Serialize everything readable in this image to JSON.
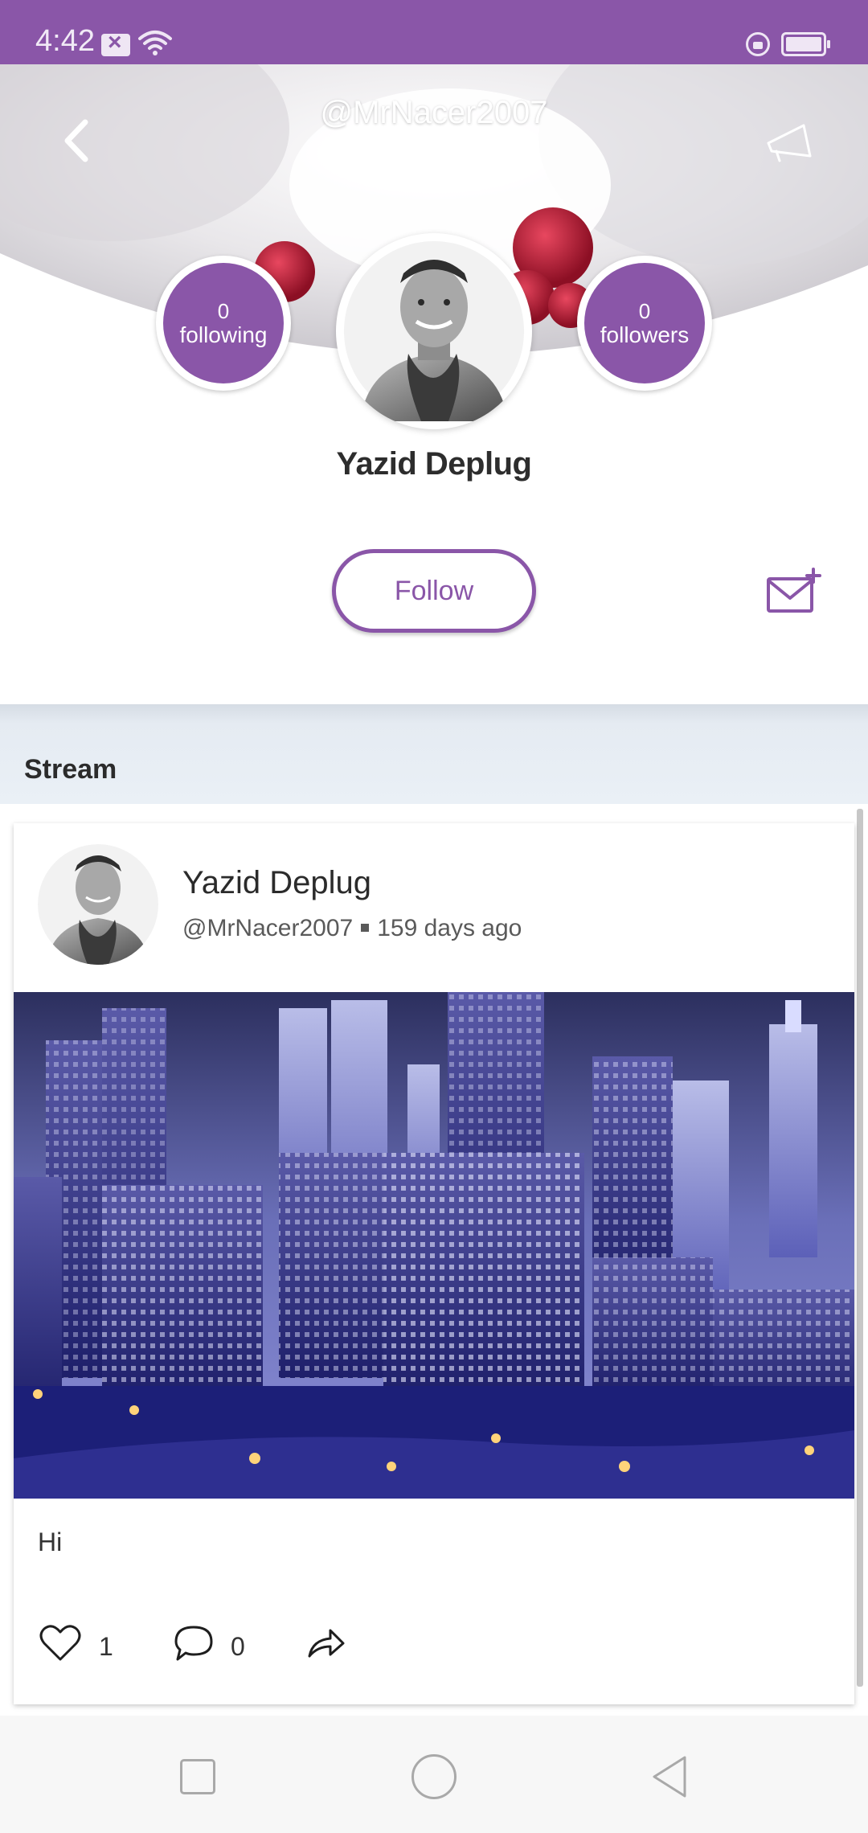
{
  "status_bar": {
    "time": "4:42",
    "background_color": "#8a56a8",
    "icons": [
      "sim-x-icon",
      "wifi-icon",
      "screen-lock-icon",
      "battery-icon"
    ]
  },
  "header": {
    "handle": "@MrNacer2007",
    "back_icon": "chevron-left-icon",
    "share_icon": "megaphone-outline-icon"
  },
  "profile": {
    "name": "Yazid Deplug",
    "following_count": "0",
    "following_label": "following",
    "followers_count": "0",
    "followers_label": "followers",
    "follow_label": "Follow",
    "message_icon": "mail-plus-icon"
  },
  "stream": {
    "title": "Stream"
  },
  "post": {
    "author": "Yazid Deplug",
    "handle": "@MrNacer2007",
    "time_ago": "159 days ago",
    "text": "Hi",
    "likes": "1",
    "comments": "0",
    "like_icon": "heart-outline-icon",
    "comment_icon": "speech-bubble-icon",
    "share_icon": "share-arrow-icon"
  },
  "nav": {
    "icons": [
      "recent-apps-icon",
      "home-icon",
      "back-triangle-icon"
    ]
  },
  "colors": {
    "accent": "#8a56a8",
    "stream_bg": "#eaf0f6",
    "text_dark": "#2d2d2d"
  }
}
